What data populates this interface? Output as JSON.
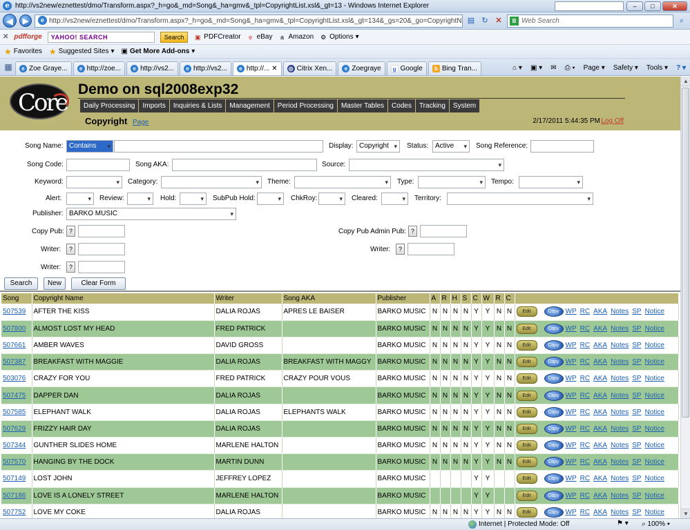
{
  "browser": {
    "window_title": "http://vs2new/eznettest/dmo/Transform.aspx?_h=go&_md=Song&_ha=gmv&_tpl=CopyrightList.xsl&_gt=13 - Windows Internet Explorer",
    "url": "http://vs2new/eznettest/dmo/Transform.aspx?_h=go&_md=Song&_ha=gmv&_tpl=CopyrightList.xsl&_gt=134&_gs=20&_go=CopyrightName&_c",
    "web_search_placeholder": "Web Search",
    "toolbar": {
      "pdfforge": "pdfforge",
      "yahoo_prefix": "enhanced by",
      "yahoo_brand": "YAHOO! SEARCH",
      "search_label": "Search",
      "pdfcreator": "PDFCreator",
      "ebay": "eBay",
      "amazon": "Amazon",
      "options": "Options"
    },
    "favorites": {
      "favorites_label": "Favorites",
      "suggested": "Suggested Sites",
      "addons": "Get More Add-ons"
    },
    "tabs": [
      {
        "label": "Zoe Graye..."
      },
      {
        "label": "http://zoe..."
      },
      {
        "label": "http://vs2..."
      },
      {
        "label": "http://vs2..."
      },
      {
        "label": "http://..."
      },
      {
        "label": "Citrix Xen..."
      },
      {
        "label": "Zoegraye"
      },
      {
        "label": "Google"
      },
      {
        "label": "Bing Tran..."
      }
    ],
    "tools": {
      "page": "Page",
      "safety": "Safety",
      "tools": "Tools"
    },
    "status": {
      "zone": "Internet | Protected Mode: Off",
      "zoom": "100%"
    }
  },
  "app": {
    "logo_text": "Core",
    "title": "Demo on sql2008exp32",
    "nav": [
      "Daily Processing",
      "Imports",
      "Inquiries & Lists",
      "Management",
      "Period Processing",
      "Master Tables",
      "Codes",
      "Tracking",
      "System"
    ],
    "page_title": "Copyright",
    "page_link": "Page",
    "datetime": "2/17/2011 5:44:35 PM",
    "logoff": "Log Off"
  },
  "form": {
    "song_name_label": "Song Name:",
    "song_name_mode": "Contains",
    "display_label": "Display:",
    "display_value": "Copyright",
    "status_label": "Status:",
    "status_value": "Active",
    "song_ref_label": "Song Reference:",
    "song_code_label": "Song Code:",
    "song_aka_label": "Song AKA:",
    "source_label": "Source:",
    "keyword_label": "Keyword:",
    "category_label": "Category:",
    "theme_label": "Theme:",
    "type_label": "Type:",
    "tempo_label": "Tempo:",
    "alert_label": "Alert:",
    "review_label": "Review:",
    "hold_label": "Hold:",
    "subpub_hold_label": "SubPub Hold:",
    "chkroy_label": "ChkRoy:",
    "cleared_label": "Cleared:",
    "territory_label": "Territory:",
    "publisher_label": "Publisher:",
    "publisher_value": "BARKO MUSIC",
    "copy_pub_label": "Copy Pub:",
    "copy_pub_admin_label": "Copy Pub Admin Pub:",
    "writer_label": "Writer:",
    "lookup_glyph": "?",
    "search_btn": "Search",
    "new_btn": "New",
    "clear_btn": "Clear Form"
  },
  "table": {
    "headers": [
      "Song",
      "Copyright Name",
      "Writer",
      "Song AKA",
      "Publisher",
      "A",
      "R",
      "H",
      "S",
      "C",
      "W",
      "R",
      "C",
      ""
    ],
    "edit_label": "Edit",
    "copy_label": "Copy",
    "links": [
      "WP",
      "RC",
      "AKA",
      "Notes",
      "SP",
      "Notice"
    ],
    "rows": [
      {
        "song": "507539",
        "name": "AFTER THE KISS",
        "writer": "DALIA ROJAS",
        "aka": "APRES LE BAISER",
        "publisher": "BARKO MUSIC",
        "flags": [
          "N",
          "N",
          "N",
          "N",
          "Y",
          "Y",
          "N",
          "N"
        ]
      },
      {
        "song": "507800",
        "name": "ALMOST LOST MY HEAD",
        "writer": "FRED PATRICK",
        "aka": "",
        "publisher": "BARKO MUSIC",
        "flags": [
          "N",
          "N",
          "N",
          "N",
          "Y",
          "Y",
          "N",
          "N"
        ]
      },
      {
        "song": "507661",
        "name": "AMBER WAVES",
        "writer": "DAVID GROSS",
        "aka": "",
        "publisher": "BARKO MUSIC",
        "flags": [
          "N",
          "N",
          "N",
          "N",
          "Y",
          "Y",
          "N",
          "N"
        ]
      },
      {
        "song": "507387",
        "name": "BREAKFAST WITH MAGGIE",
        "writer": "DALIA ROJAS",
        "aka": "BREAKFAST WITH MAGGY",
        "publisher": "BARKO MUSIC",
        "flags": [
          "N",
          "N",
          "N",
          "N",
          "Y",
          "Y",
          "N",
          "N"
        ]
      },
      {
        "song": "503076",
        "name": "CRAZY FOR YOU",
        "writer": "FRED PATRICK",
        "aka": "CRAZY POUR VOUS",
        "publisher": "BARKO MUSIC",
        "flags": [
          "N",
          "N",
          "N",
          "N",
          "Y",
          "Y",
          "N",
          "N"
        ]
      },
      {
        "song": "507475",
        "name": "DAPPER DAN",
        "writer": "DALIA ROJAS",
        "aka": "",
        "publisher": "BARKO MUSIC",
        "flags": [
          "N",
          "N",
          "N",
          "N",
          "Y",
          "Y",
          "N",
          "N"
        ]
      },
      {
        "song": "507585",
        "name": "ELEPHANT WALK",
        "writer": "DALIA ROJAS",
        "aka": "ELEPHANTS WALK",
        "publisher": "BARKO MUSIC",
        "flags": [
          "N",
          "N",
          "N",
          "N",
          "Y",
          "Y",
          "N",
          "N"
        ]
      },
      {
        "song": "507629",
        "name": "FRIZZY HAIR DAY",
        "writer": "DALIA ROJAS",
        "aka": "",
        "publisher": "BARKO MUSIC",
        "flags": [
          "N",
          "N",
          "N",
          "N",
          "Y",
          "Y",
          "N",
          "N"
        ]
      },
      {
        "song": "507344",
        "name": "GUNTHER SLIDES HOME",
        "writer": "MARLENE HALTON",
        "aka": "",
        "publisher": "BARKO MUSIC",
        "flags": [
          "N",
          "N",
          "N",
          "N",
          "Y",
          "Y",
          "N",
          "N"
        ]
      },
      {
        "song": "507570",
        "name": "HANGING BY THE DOCK",
        "writer": "MARTIN DUNN",
        "aka": "",
        "publisher": "BARKO MUSIC",
        "flags": [
          "N",
          "N",
          "N",
          "N",
          "Y",
          "Y",
          "N",
          "N"
        ]
      },
      {
        "song": "507149",
        "name": "LOST JOHN",
        "writer": "JEFFREY LOPEZ",
        "aka": "",
        "publisher": "BARKO MUSIC",
        "flags": [
          "",
          "",
          "",
          "",
          "Y",
          "Y",
          "",
          ""
        ]
      },
      {
        "song": "507186",
        "name": "LOVE IS A LONELY STREET",
        "writer": "MARLENE HALTON",
        "aka": "",
        "publisher": "BARKO MUSIC",
        "flags": [
          "",
          "",
          "",
          "",
          "Y",
          "Y",
          "",
          ""
        ]
      },
      {
        "song": "507752",
        "name": "LOVE MY COKE",
        "writer": "DALIA ROJAS",
        "aka": "",
        "publisher": "BARKO MUSIC",
        "flags": [
          "N",
          "N",
          "N",
          "N",
          "Y",
          "Y",
          "N",
          "N"
        ]
      }
    ]
  }
}
